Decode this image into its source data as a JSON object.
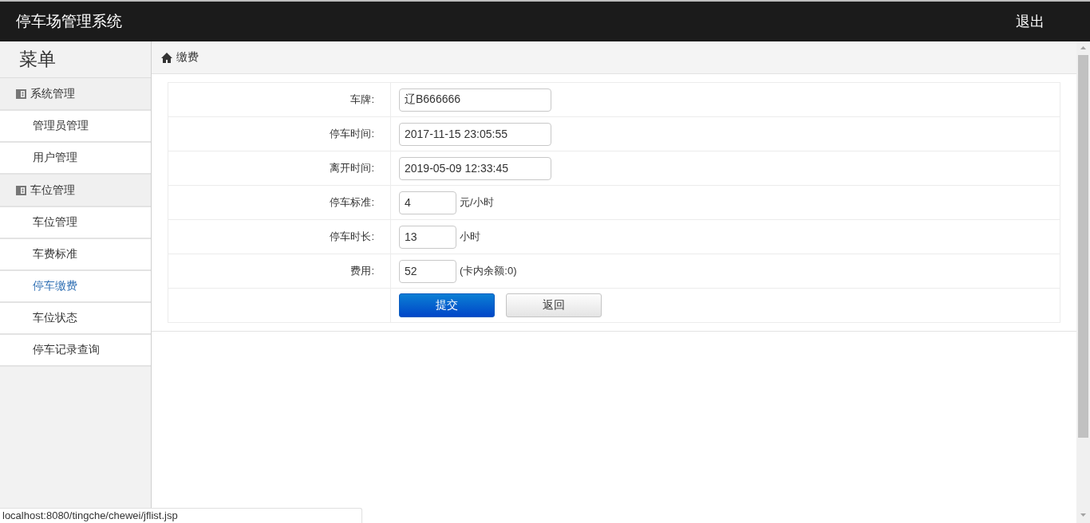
{
  "header": {
    "title": "停车场管理系统",
    "logout": "退出"
  },
  "sidebar": {
    "title": "菜单",
    "groups": [
      {
        "label": "系统管理",
        "items": [
          {
            "label": "管理员管理",
            "selected": false
          },
          {
            "label": "用户管理",
            "selected": false
          }
        ]
      },
      {
        "label": "车位管理",
        "items": [
          {
            "label": "车位管理",
            "selected": false
          },
          {
            "label": "车费标准",
            "selected": false
          },
          {
            "label": "停车缴费",
            "selected": true
          },
          {
            "label": "车位状态",
            "selected": false
          },
          {
            "label": "停车记录查询",
            "selected": false
          }
        ]
      }
    ]
  },
  "breadcrumb": "缴费",
  "form": {
    "rows": [
      {
        "label": "车牌:",
        "value": "辽B666666"
      },
      {
        "label": "停车时间:",
        "value": "2017-11-15 23:05:55"
      },
      {
        "label": "离开时间:",
        "value": "2019-05-09 12:33:45"
      },
      {
        "label": "停车标准:",
        "value": "4",
        "suffix": "元/小时"
      },
      {
        "label": "停车时长:",
        "value": "13",
        "suffix": "小时"
      },
      {
        "label": "费用:",
        "value": "52",
        "suffix": "(卡内余额:0)"
      }
    ],
    "buttons": [
      {
        "label": "提交",
        "kind": "primary"
      },
      {
        "label": "返回",
        "kind": "default"
      }
    ]
  },
  "status_bar": "localhost:8080/tingche/chewei/jflist.jsp"
}
